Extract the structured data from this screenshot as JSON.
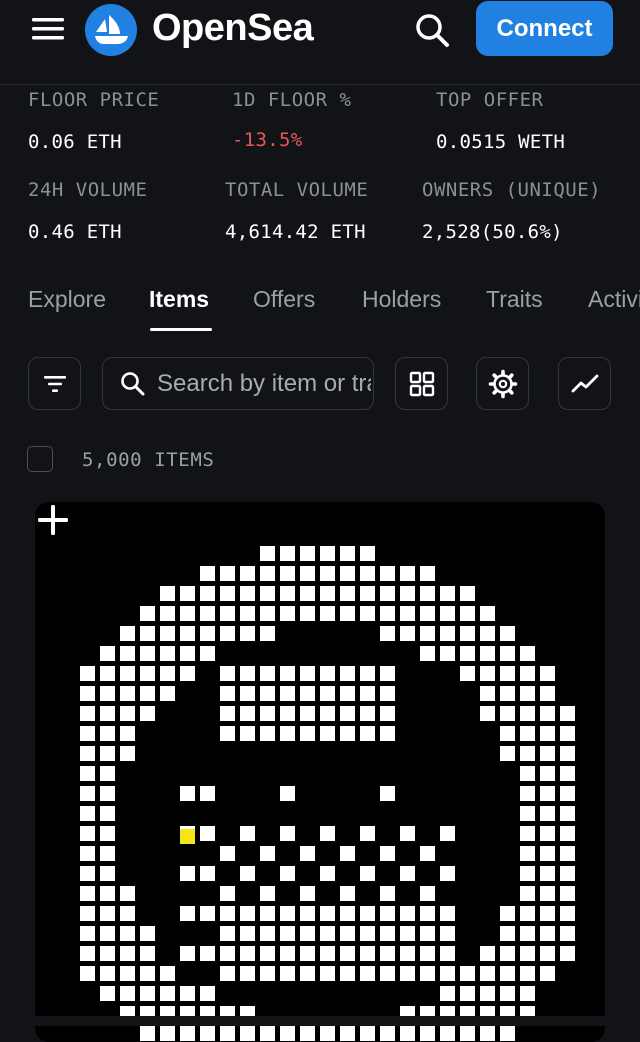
{
  "header": {
    "brand": "OpenSea",
    "connect_label": "Connect",
    "accent": "#2081e2"
  },
  "stats": [
    {
      "label": "FLOOR PRICE",
      "value": "0.06 ETH"
    },
    {
      "label": "1D FLOOR %",
      "value": "-13.5%"
    },
    {
      "label": "TOP OFFER",
      "value": "0.0515 WETH"
    },
    {
      "label": "24H VOLUME",
      "value": "0.46 ETH"
    },
    {
      "label": "TOTAL VOLUME",
      "value": "4,614.42 ETH"
    },
    {
      "label": "OWNERS (UNIQUE)",
      "value": "2,528(50.6%)"
    }
  ],
  "tabs": [
    {
      "label": "Explore"
    },
    {
      "label": "Items",
      "active": true
    },
    {
      "label": "Offers"
    },
    {
      "label": "Holders"
    },
    {
      "label": "Traits"
    },
    {
      "label": "Activity"
    }
  ],
  "search": {
    "placeholder": "Search by item or trait"
  },
  "toolbar": {
    "icons": [
      "filter-icon",
      "search-icon",
      "grid-icon",
      "gear-icon",
      "chart-icon"
    ]
  },
  "items": {
    "count_label": "5,000 ITEMS"
  },
  "colors": {
    "background": "#121317",
    "negative": "#eb5757",
    "highlight_pixel": "#f5e613"
  }
}
